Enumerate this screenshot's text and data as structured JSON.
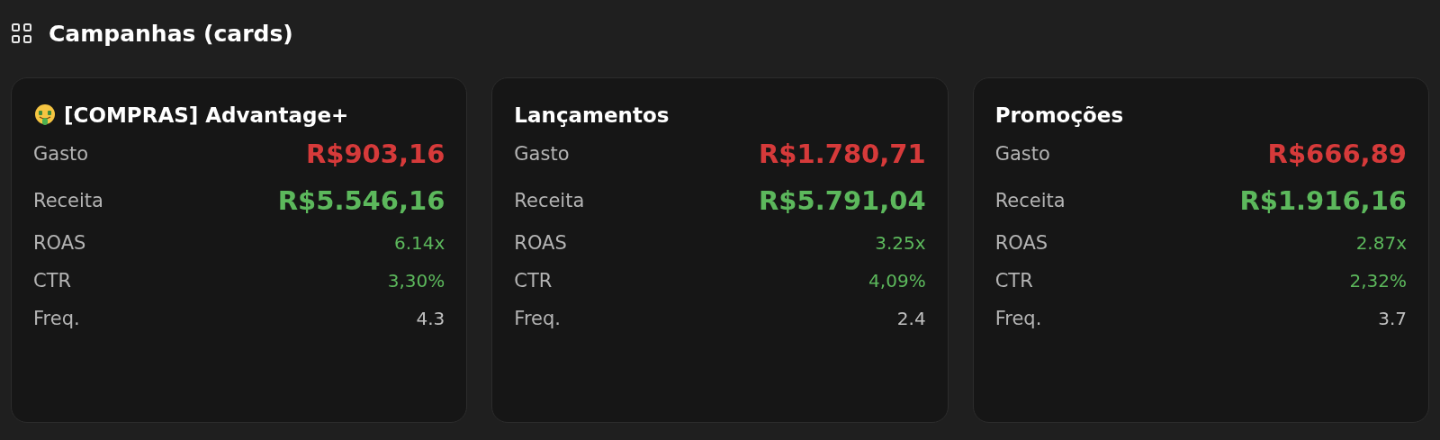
{
  "header": {
    "title": "Campanhas (cards)"
  },
  "cards": [
    {
      "kind": "emoji",
      "title": "[COMPRAS] Advantage+",
      "metrics": [
        {
          "label": "Gasto",
          "value": "R$903,16",
          "kind": "major",
          "color": "#d63a3a"
        },
        {
          "label": "Receita",
          "value": "R$5.546,16",
          "kind": "major",
          "color": "#5cb85c"
        },
        {
          "label": "ROAS",
          "value": "6.14x",
          "kind": "minor",
          "color": "#5cb85c"
        },
        {
          "label": "CTR",
          "value": "3,30%",
          "kind": "minor",
          "color": "#5cb85c"
        },
        {
          "label": "Freq.",
          "value": "4.3",
          "kind": "minor",
          "color": "#c0c0c0"
        }
      ]
    },
    {
      "kind": "plain",
      "title": "Lançamentos",
      "metrics": [
        {
          "label": "Gasto",
          "value": "R$1.780,71",
          "kind": "major",
          "color": "#d63a3a"
        },
        {
          "label": "Receita",
          "value": "R$5.791,04",
          "kind": "major",
          "color": "#5cb85c"
        },
        {
          "label": "ROAS",
          "value": "3.25x",
          "kind": "minor",
          "color": "#5cb85c"
        },
        {
          "label": "CTR",
          "value": "4,09%",
          "kind": "minor",
          "color": "#5cb85c"
        },
        {
          "label": "Freq.",
          "value": "2.4",
          "kind": "minor",
          "color": "#c0c0c0"
        }
      ]
    },
    {
      "kind": "plain",
      "title": "Promoções",
      "metrics": [
        {
          "label": "Gasto",
          "value": "R$666,89",
          "kind": "major",
          "color": "#d63a3a"
        },
        {
          "label": "Receita",
          "value": "R$1.916,16",
          "kind": "major",
          "color": "#5cb85c"
        },
        {
          "label": "ROAS",
          "value": "2.87x",
          "kind": "minor",
          "color": "#5cb85c"
        },
        {
          "label": "CTR",
          "value": "2,32%",
          "kind": "minor",
          "color": "#5cb85c"
        },
        {
          "label": "Freq.",
          "value": "3.7",
          "kind": "minor",
          "color": "#c0c0c0"
        }
      ]
    }
  ]
}
